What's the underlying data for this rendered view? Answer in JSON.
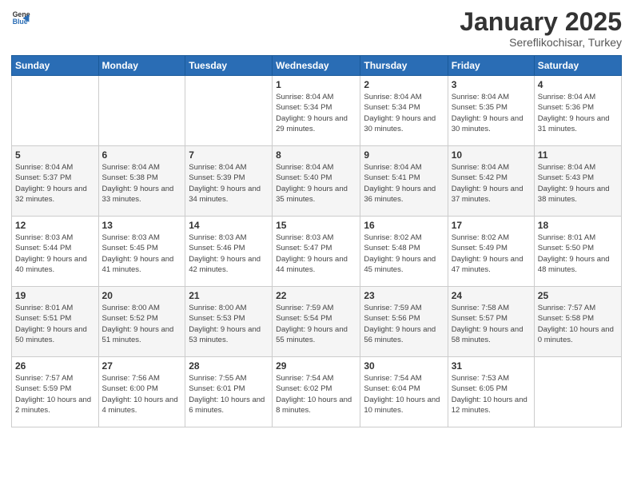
{
  "header": {
    "logo": {
      "general": "General",
      "blue": "Blue"
    },
    "title": "January 2025",
    "location": "Sereflikochisar, Turkey"
  },
  "weekdays": [
    "Sunday",
    "Monday",
    "Tuesday",
    "Wednesday",
    "Thursday",
    "Friday",
    "Saturday"
  ],
  "weeks": [
    [
      {
        "day": "",
        "sunrise": "",
        "sunset": "",
        "daylight": ""
      },
      {
        "day": "",
        "sunrise": "",
        "sunset": "",
        "daylight": ""
      },
      {
        "day": "",
        "sunrise": "",
        "sunset": "",
        "daylight": ""
      },
      {
        "day": "1",
        "sunrise": "Sunrise: 8:04 AM",
        "sunset": "Sunset: 5:34 PM",
        "daylight": "Daylight: 9 hours and 29 minutes."
      },
      {
        "day": "2",
        "sunrise": "Sunrise: 8:04 AM",
        "sunset": "Sunset: 5:34 PM",
        "daylight": "Daylight: 9 hours and 30 minutes."
      },
      {
        "day": "3",
        "sunrise": "Sunrise: 8:04 AM",
        "sunset": "Sunset: 5:35 PM",
        "daylight": "Daylight: 9 hours and 30 minutes."
      },
      {
        "day": "4",
        "sunrise": "Sunrise: 8:04 AM",
        "sunset": "Sunset: 5:36 PM",
        "daylight": "Daylight: 9 hours and 31 minutes."
      }
    ],
    [
      {
        "day": "5",
        "sunrise": "Sunrise: 8:04 AM",
        "sunset": "Sunset: 5:37 PM",
        "daylight": "Daylight: 9 hours and 32 minutes."
      },
      {
        "day": "6",
        "sunrise": "Sunrise: 8:04 AM",
        "sunset": "Sunset: 5:38 PM",
        "daylight": "Daylight: 9 hours and 33 minutes."
      },
      {
        "day": "7",
        "sunrise": "Sunrise: 8:04 AM",
        "sunset": "Sunset: 5:39 PM",
        "daylight": "Daylight: 9 hours and 34 minutes."
      },
      {
        "day": "8",
        "sunrise": "Sunrise: 8:04 AM",
        "sunset": "Sunset: 5:40 PM",
        "daylight": "Daylight: 9 hours and 35 minutes."
      },
      {
        "day": "9",
        "sunrise": "Sunrise: 8:04 AM",
        "sunset": "Sunset: 5:41 PM",
        "daylight": "Daylight: 9 hours and 36 minutes."
      },
      {
        "day": "10",
        "sunrise": "Sunrise: 8:04 AM",
        "sunset": "Sunset: 5:42 PM",
        "daylight": "Daylight: 9 hours and 37 minutes."
      },
      {
        "day": "11",
        "sunrise": "Sunrise: 8:04 AM",
        "sunset": "Sunset: 5:43 PM",
        "daylight": "Daylight: 9 hours and 38 minutes."
      }
    ],
    [
      {
        "day": "12",
        "sunrise": "Sunrise: 8:03 AM",
        "sunset": "Sunset: 5:44 PM",
        "daylight": "Daylight: 9 hours and 40 minutes."
      },
      {
        "day": "13",
        "sunrise": "Sunrise: 8:03 AM",
        "sunset": "Sunset: 5:45 PM",
        "daylight": "Daylight: 9 hours and 41 minutes."
      },
      {
        "day": "14",
        "sunrise": "Sunrise: 8:03 AM",
        "sunset": "Sunset: 5:46 PM",
        "daylight": "Daylight: 9 hours and 42 minutes."
      },
      {
        "day": "15",
        "sunrise": "Sunrise: 8:03 AM",
        "sunset": "Sunset: 5:47 PM",
        "daylight": "Daylight: 9 hours and 44 minutes."
      },
      {
        "day": "16",
        "sunrise": "Sunrise: 8:02 AM",
        "sunset": "Sunset: 5:48 PM",
        "daylight": "Daylight: 9 hours and 45 minutes."
      },
      {
        "day": "17",
        "sunrise": "Sunrise: 8:02 AM",
        "sunset": "Sunset: 5:49 PM",
        "daylight": "Daylight: 9 hours and 47 minutes."
      },
      {
        "day": "18",
        "sunrise": "Sunrise: 8:01 AM",
        "sunset": "Sunset: 5:50 PM",
        "daylight": "Daylight: 9 hours and 48 minutes."
      }
    ],
    [
      {
        "day": "19",
        "sunrise": "Sunrise: 8:01 AM",
        "sunset": "Sunset: 5:51 PM",
        "daylight": "Daylight: 9 hours and 50 minutes."
      },
      {
        "day": "20",
        "sunrise": "Sunrise: 8:00 AM",
        "sunset": "Sunset: 5:52 PM",
        "daylight": "Daylight: 9 hours and 51 minutes."
      },
      {
        "day": "21",
        "sunrise": "Sunrise: 8:00 AM",
        "sunset": "Sunset: 5:53 PM",
        "daylight": "Daylight: 9 hours and 53 minutes."
      },
      {
        "day": "22",
        "sunrise": "Sunrise: 7:59 AM",
        "sunset": "Sunset: 5:54 PM",
        "daylight": "Daylight: 9 hours and 55 minutes."
      },
      {
        "day": "23",
        "sunrise": "Sunrise: 7:59 AM",
        "sunset": "Sunset: 5:56 PM",
        "daylight": "Daylight: 9 hours and 56 minutes."
      },
      {
        "day": "24",
        "sunrise": "Sunrise: 7:58 AM",
        "sunset": "Sunset: 5:57 PM",
        "daylight": "Daylight: 9 hours and 58 minutes."
      },
      {
        "day": "25",
        "sunrise": "Sunrise: 7:57 AM",
        "sunset": "Sunset: 5:58 PM",
        "daylight": "Daylight: 10 hours and 0 minutes."
      }
    ],
    [
      {
        "day": "26",
        "sunrise": "Sunrise: 7:57 AM",
        "sunset": "Sunset: 5:59 PM",
        "daylight": "Daylight: 10 hours and 2 minutes."
      },
      {
        "day": "27",
        "sunrise": "Sunrise: 7:56 AM",
        "sunset": "Sunset: 6:00 PM",
        "daylight": "Daylight: 10 hours and 4 minutes."
      },
      {
        "day": "28",
        "sunrise": "Sunrise: 7:55 AM",
        "sunset": "Sunset: 6:01 PM",
        "daylight": "Daylight: 10 hours and 6 minutes."
      },
      {
        "day": "29",
        "sunrise": "Sunrise: 7:54 AM",
        "sunset": "Sunset: 6:02 PM",
        "daylight": "Daylight: 10 hours and 8 minutes."
      },
      {
        "day": "30",
        "sunrise": "Sunrise: 7:54 AM",
        "sunset": "Sunset: 6:04 PM",
        "daylight": "Daylight: 10 hours and 10 minutes."
      },
      {
        "day": "31",
        "sunrise": "Sunrise: 7:53 AM",
        "sunset": "Sunset: 6:05 PM",
        "daylight": "Daylight: 10 hours and 12 minutes."
      },
      {
        "day": "",
        "sunrise": "",
        "sunset": "",
        "daylight": ""
      }
    ]
  ]
}
